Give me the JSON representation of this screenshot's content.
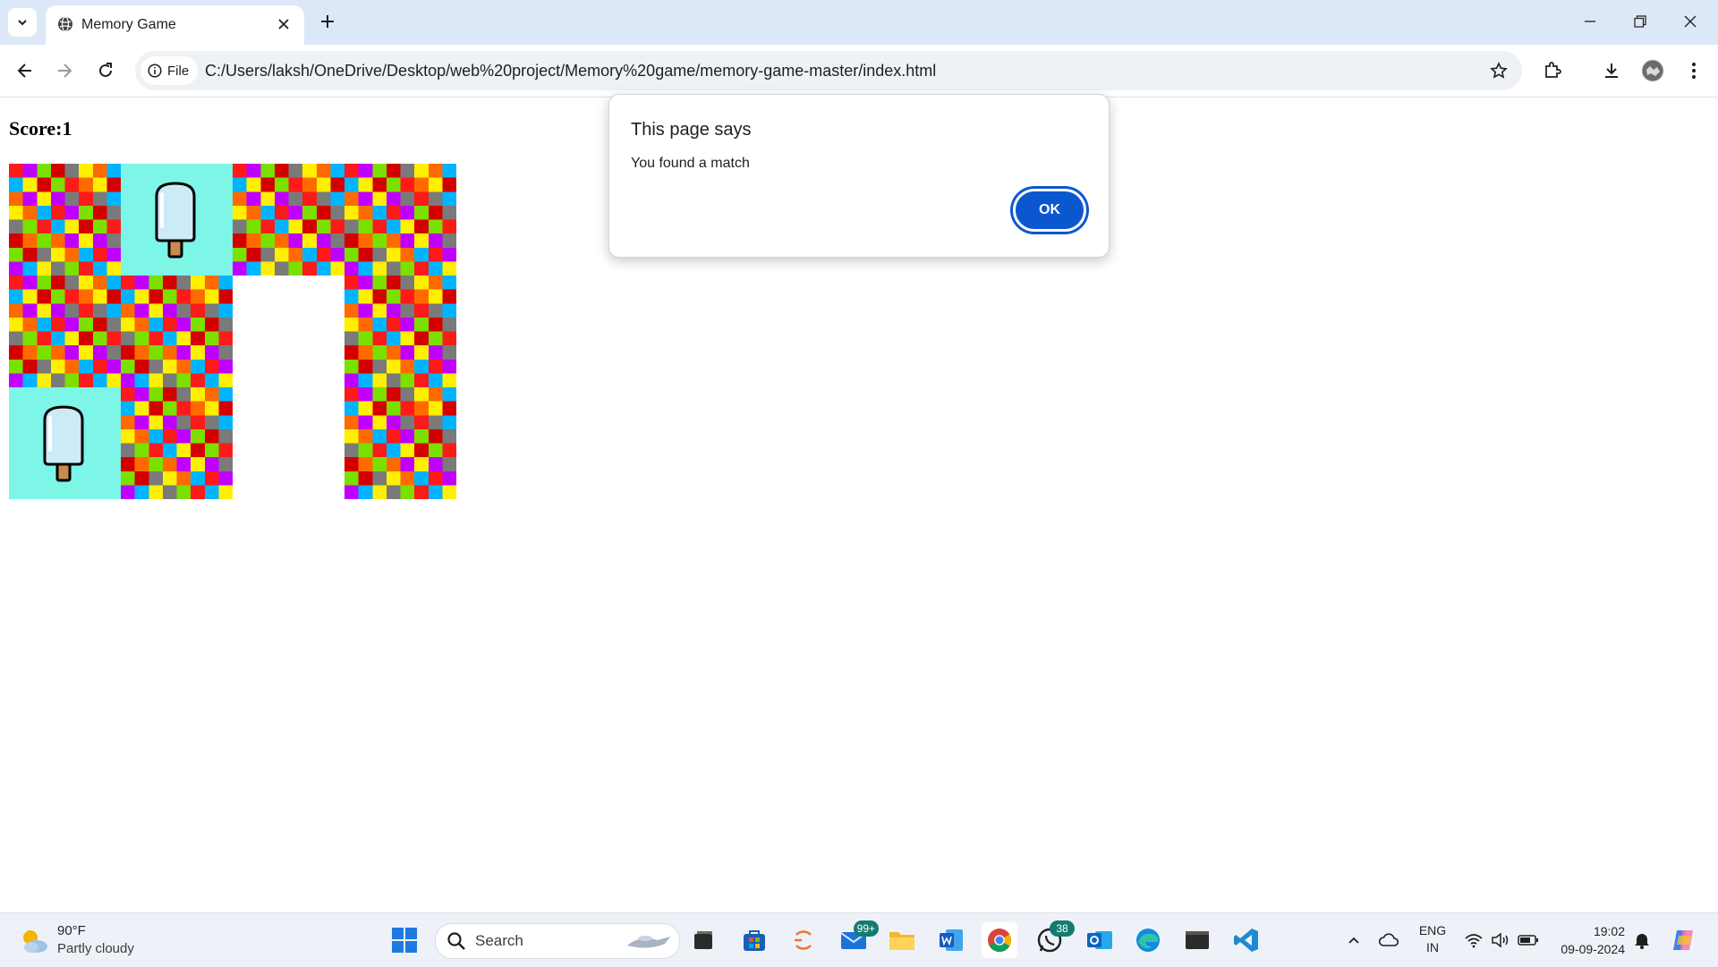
{
  "browser": {
    "tab_title": "Memory Game",
    "url_chip": "File",
    "url": "C:/Users/laksh/OneDrive/Desktop/web%20project/Memory%20game/memory-game-master/index.html"
  },
  "page": {
    "score_label": "Score:1",
    "board": {
      "columns": 4,
      "rows": 3,
      "cards": [
        {
          "state": "back"
        },
        {
          "state": "face",
          "image": "popsicle-icon"
        },
        {
          "state": "back"
        },
        {
          "state": "back"
        },
        {
          "state": "back"
        },
        {
          "state": "back"
        },
        {
          "state": "removed"
        },
        {
          "state": "back"
        },
        {
          "state": "face",
          "image": "popsicle-icon"
        },
        {
          "state": "back"
        },
        {
          "state": "removed"
        },
        {
          "state": "back"
        }
      ]
    }
  },
  "dialog": {
    "title": "This page says",
    "message": "You found a match",
    "ok_label": "OK"
  },
  "taskbar": {
    "weather_temp": "90°F",
    "weather_desc": "Partly cloudy",
    "search_placeholder": "Search",
    "mail_badge": "99+",
    "whatsapp_badge": "38",
    "lang_line1": "ENG",
    "lang_line2": "IN",
    "time": "19:02",
    "date": "09-09-2024"
  },
  "colors": {
    "accent": "#0b57d0",
    "tabbar": "#dce7f8",
    "card_face": "#7df5e7"
  }
}
